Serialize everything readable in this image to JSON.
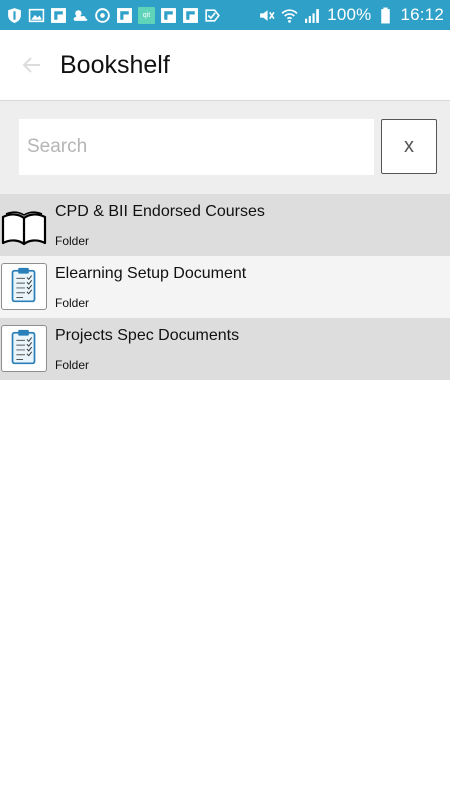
{
  "status_bar": {
    "battery": "100%",
    "time": "16:12",
    "qit_label": "qit",
    "left_icons": [
      "shield-icon",
      "image-icon",
      "flipboard-icon",
      "weather-icon",
      "sync-icon",
      "flipboard-icon",
      "qit-icon",
      "flipboard-icon",
      "flipboard-icon",
      "check-icon"
    ],
    "right_icons": [
      "mute-icon",
      "wifi-icon",
      "signal-icon",
      "battery-icon"
    ]
  },
  "app_bar": {
    "title": "Bookshelf",
    "back_icon": "arrow-left-icon"
  },
  "search": {
    "placeholder": "Search",
    "value": "",
    "clear_label": "x"
  },
  "items": [
    {
      "title": "CPD & BII Endorsed Courses",
      "subtitle": "Folder",
      "icon": "book-icon"
    },
    {
      "title": "Elearning Setup Document",
      "subtitle": "Folder",
      "icon": "clipboard-icon"
    },
    {
      "title": "Projects Spec Documents",
      "subtitle": "Folder",
      "icon": "clipboard-icon"
    }
  ],
  "colors": {
    "status_bar": "#2fa0c8",
    "row_shade": "#dddddd",
    "row_light": "#f4f4f4",
    "search_bg": "#eeeeee"
  }
}
